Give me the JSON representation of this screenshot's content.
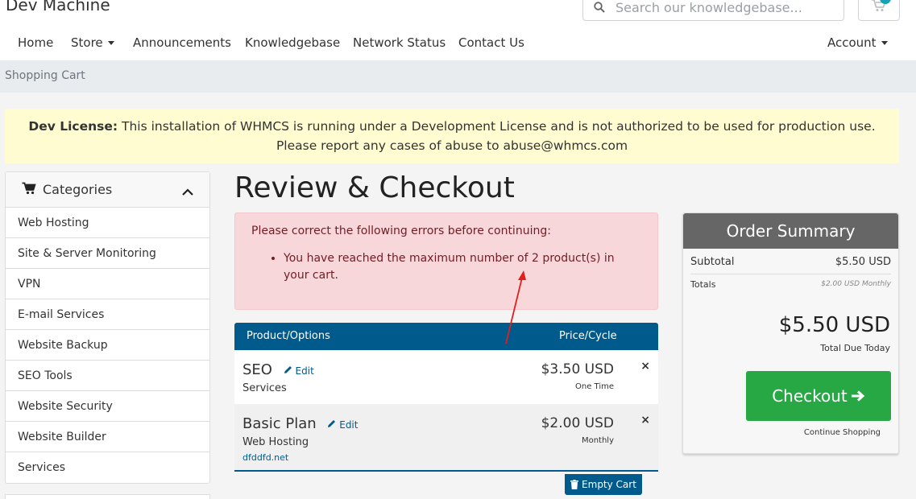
{
  "header": {
    "brand": "Dev Machine",
    "search_placeholder": "Search our knowledgebase..."
  },
  "nav": {
    "items": [
      "Home",
      "Store",
      "Announcements",
      "Knowledgebase",
      "Network Status",
      "Contact Us"
    ],
    "account": "Account"
  },
  "breadcrumb": "Shopping Cart",
  "license": {
    "label": "Dev License:",
    "line1": "This installation of WHMCS is running under a Development License and is not authorized to be used for production use.",
    "line2": "Please report any cases of abuse to abuse@whmcs.com"
  },
  "sidebar": {
    "title": "Categories",
    "items": [
      "Web Hosting",
      "Site & Server Monitoring",
      "VPN",
      "E-mail Services",
      "Website Backup",
      "SEO Tools",
      "Website Security",
      "Website Builder",
      "Services"
    ]
  },
  "main": {
    "title": "Review & Checkout",
    "error_heading": "Please correct the following errors before continuing:",
    "error_item": "You have reached the maximum number of 2 product(s) in your cart."
  },
  "cart": {
    "col_product": "Product/Options",
    "col_price": "Price/Cycle",
    "edit_label": "Edit",
    "remove_label": "×",
    "items": [
      {
        "name": "SEO",
        "group": "Services",
        "domain": "",
        "price": "$3.50 USD",
        "cycle": "One Time"
      },
      {
        "name": "Basic Plan",
        "group": "Web Hosting",
        "domain": "dfddfd.net",
        "price": "$2.00 USD",
        "cycle": "Monthly"
      }
    ],
    "empty_label": "Empty Cart"
  },
  "summary": {
    "title": "Order Summary",
    "subtotal_label": "Subtotal",
    "subtotal_value": "$5.50 USD",
    "totals_label": "Totals",
    "totals_value": "$2.00 USD Monthly",
    "total": "$5.50 USD",
    "total_label": "Total Due Today",
    "checkout_label": "Checkout",
    "continue_label": "Continue Shopping"
  },
  "colors": {
    "primary": "#005a8c",
    "success": "#28a745",
    "alert_bg": "#f8d7da",
    "license_bg": "#fffcd1",
    "annotation": "#e0201e"
  }
}
